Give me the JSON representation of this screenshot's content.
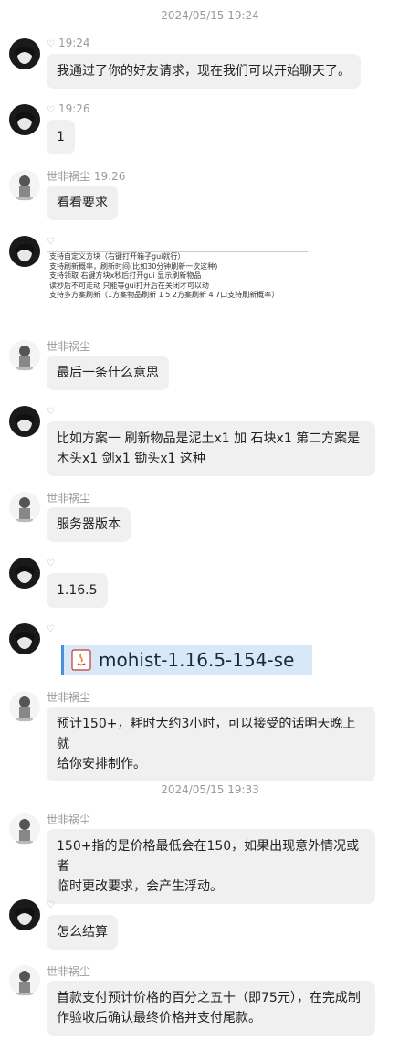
{
  "timestamps": [
    "2024/05/15 19:24",
    "2024/05/15 19:33"
  ],
  "messages": [
    {
      "sender": "",
      "time": "19:24",
      "text": "我通过了你的好友请求，现在我们可以开始聊天了。"
    },
    {
      "sender": "",
      "time": "19:26",
      "text": "1"
    },
    {
      "sender": "世非祸尘",
      "time": "19:26",
      "text": "看看要求"
    },
    {
      "sender": "",
      "time": "",
      "image_lines": [
        "支持自定义方块（右键打开箱子gui就行）",
        "支持刷新概率，刷新时间(比如30分钟刷新一次这种)",
        "支持领取 右键方块x秒后打开gui 显示刷新物品",
        "读秒后不可走动 只能等gui打开后在关闭才可以动",
        "支持多方案刷新（1方案物品刷新 1 5    2方案刷新 4 7口支持刷新概率）"
      ]
    },
    {
      "sender": "世非祸尘",
      "time": "",
      "text": "最后一条什么意思"
    },
    {
      "sender": "",
      "time": "",
      "line1": "比如方案一 刷新物品是泥土x1 加 石块x1 第二方案是",
      "line2": "木头x1 剑x1 锄头x1 这种"
    },
    {
      "sender": "世非祸尘",
      "time": "",
      "text": "服务器版本"
    },
    {
      "sender": "",
      "time": "",
      "text": "1.16.5"
    },
    {
      "sender": "",
      "time": "",
      "file_name": "mohist-1.16.5-154-se"
    },
    {
      "sender": "世非祸尘",
      "time": "",
      "line1": "预计150+，耗时大约3小时，可以接受的话明天晚上就",
      "line2": "给你安排制作。"
    },
    {
      "sender": "世非祸尘",
      "time": "",
      "line1": "150+指的是价格最低会在150，如果出现意外情况或者",
      "line2": "临时更改要求，会产生浮动。"
    },
    {
      "sender": "",
      "time": "",
      "text": "怎么结算"
    },
    {
      "sender": "世非祸尘",
      "time": "",
      "line1": "首款支付预计价格的百分之五十（即75元），在完成制",
      "line2": "作验收后确认最终价格并支付尾款。"
    }
  ],
  "icons": {
    "heart": "♡"
  },
  "colors": {
    "bubble": "#f0f0f0",
    "meta": "#9a9a9a",
    "file_banner": "#d8e8f8"
  }
}
